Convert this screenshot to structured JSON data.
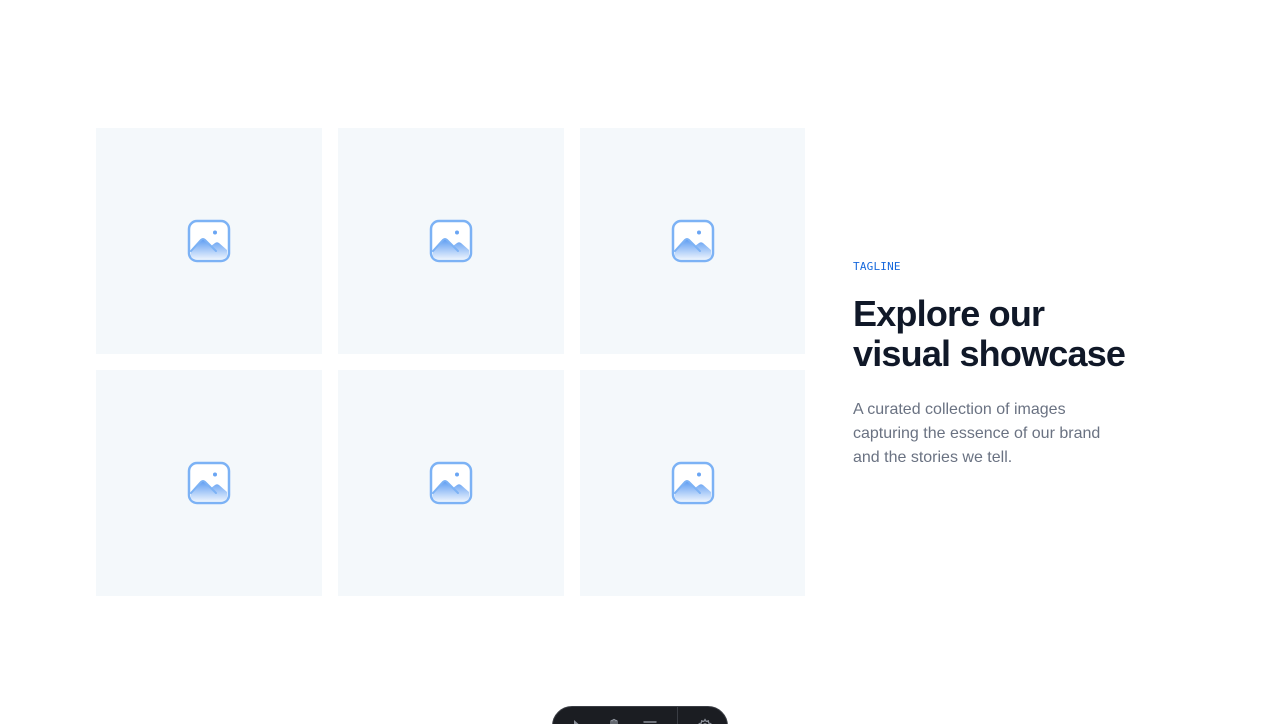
{
  "gallery": {
    "images": [
      {
        "icon": "image-placeholder-icon"
      },
      {
        "icon": "image-placeholder-icon"
      },
      {
        "icon": "image-placeholder-icon"
      },
      {
        "icon": "image-placeholder-icon"
      },
      {
        "icon": "image-placeholder-icon"
      },
      {
        "icon": "image-placeholder-icon"
      }
    ]
  },
  "hero": {
    "tagline": "TAGLINE",
    "headline": "Explore our visual showcase",
    "description": "A curated collection of images capturing the essence of our brand and the stories we tell."
  },
  "toolbar": {
    "icons": [
      "pointer-icon",
      "hand-icon",
      "menu-icon",
      "settings-icon"
    ]
  },
  "colors": {
    "accent": "#1668dc",
    "heading": "#101828",
    "body_text": "#6a7282",
    "tile_background": "#f4f8fb",
    "icon_stroke": "#7cb2f5",
    "toolbar_background": "#1b1d22"
  }
}
